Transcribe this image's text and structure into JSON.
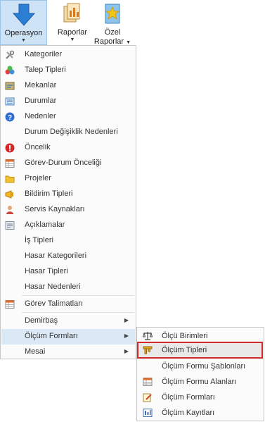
{
  "ribbon": {
    "buttons": [
      {
        "label": "Operasyon",
        "icon": "down-arrow-icon"
      },
      {
        "label": "Raporlar",
        "icon": "report-icon"
      },
      {
        "label": "Özel",
        "label2": "Raporlar",
        "icon": "star-book-icon"
      }
    ]
  },
  "menu": {
    "items": [
      {
        "label": "Kategoriler",
        "icon": "tools-icon"
      },
      {
        "label": "Talep Tipleri",
        "icon": "shapes-icon"
      },
      {
        "label": "Mekanlar",
        "icon": "map-icon"
      },
      {
        "label": "Durumlar",
        "icon": "list-icon"
      },
      {
        "label": "Nedenler",
        "icon": "help-icon"
      },
      {
        "label": "Durum Değişiklik Nedenleri",
        "icon": ""
      },
      {
        "label": "Öncelik",
        "icon": "alert-icon"
      },
      {
        "label": "Görev-Durum Önceliği",
        "icon": "table-icon"
      },
      {
        "label": "Projeler",
        "icon": "folder-icon"
      },
      {
        "label": "Bildirim Tipleri",
        "icon": "megaphone-icon"
      },
      {
        "label": "Servis Kaynakları",
        "icon": "person-icon"
      },
      {
        "label": "Açıklamalar",
        "icon": "notes-icon"
      },
      {
        "label": "İş Tipleri",
        "icon": ""
      },
      {
        "label": "Hasar Kategorileri",
        "icon": ""
      },
      {
        "label": "Hasar Tipleri",
        "icon": ""
      },
      {
        "label": "Hasar Nedenleri",
        "icon": ""
      },
      {
        "label": "Görev Talimatları",
        "icon": "table-icon"
      },
      {
        "label": "Demirbaş",
        "icon": "",
        "submenu": true
      },
      {
        "label": "Ölçüm Formları",
        "icon": "",
        "submenu": true,
        "highlighted": true
      },
      {
        "label": "Mesai",
        "icon": "",
        "submenu": true
      }
    ]
  },
  "submenu": {
    "items": [
      {
        "label": "Ölçü Birimleri",
        "icon": "scale-icon"
      },
      {
        "label": "Ölçüm Tipleri",
        "icon": "caliper-icon",
        "highlighted": true
      },
      {
        "label": "Ölçüm Formu Şablonları",
        "icon": ""
      },
      {
        "label": "Ölçüm Formu Alanları",
        "icon": "table-icon"
      },
      {
        "label": "Ölçüm Formları",
        "icon": "form-edit-icon"
      },
      {
        "label": "Ölçüm Kayıtları",
        "icon": "records-icon"
      }
    ]
  },
  "colors": {
    "highlight": "#dbe8f6",
    "selection_box": "#d62a2a",
    "ribbon_active": "#cfe3f7"
  }
}
